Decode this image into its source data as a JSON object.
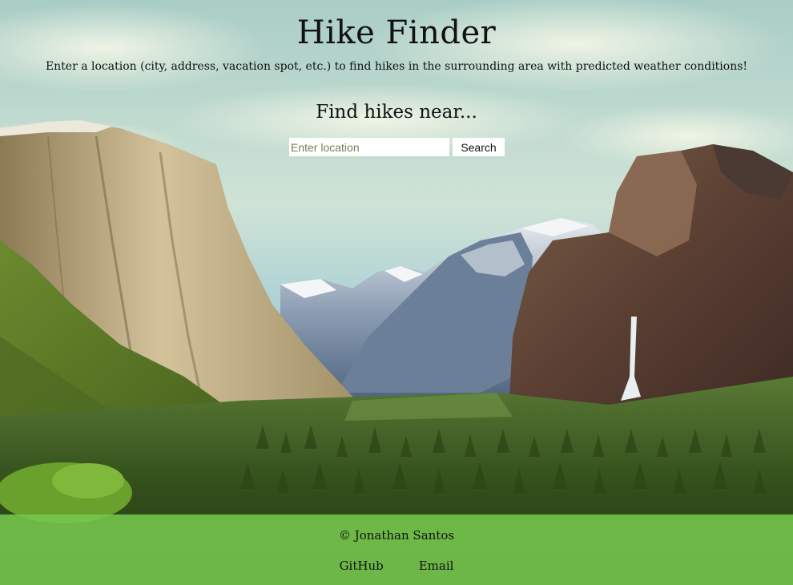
{
  "header": {
    "title": "Hike Finder",
    "subtitle": "Enter a location (city, address, vacation spot, etc.) to find hikes in the surrounding area with predicted weather conditions!"
  },
  "search": {
    "heading": "Find hikes near...",
    "placeholder": "Enter location",
    "value": "",
    "button_label": "Search"
  },
  "footer": {
    "copyright": "© Jonathan Santos",
    "links": [
      {
        "label": "GitHub"
      },
      {
        "label": "Email"
      }
    ]
  },
  "colors": {
    "footer_background": "#76c84e",
    "sky": "#b8d6d0",
    "forest": "#3e5a1f",
    "cliff": "#c9b48a"
  },
  "background_image": "yosemite-valley-landscape"
}
